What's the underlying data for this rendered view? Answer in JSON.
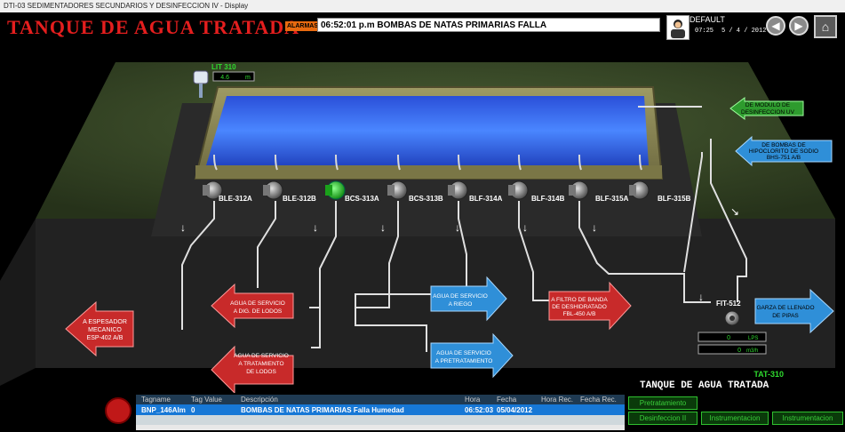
{
  "window": {
    "title": "DTI-03 SEDIMENTADORES SECUNDARIOS Y DESINFECCION IV - Display"
  },
  "header": {
    "title": "TANQUE DE AGUA TRATADA",
    "alarm_label": "ALARMAS",
    "alarm_message": "06:52:01 p.m BOMBAS DE NATAS PRIMARIAS FALLA",
    "user": "DEFAULT",
    "time": "07:25",
    "date": "5 / 4 / 2012"
  },
  "tank": {
    "level_tag": "LIT 310",
    "level_value": "4.6",
    "level_unit": "m"
  },
  "pumps": [
    {
      "label": "BLE-312A",
      "state": "off"
    },
    {
      "label": "BLE-312B",
      "state": "off"
    },
    {
      "label": "BCS-313A",
      "state": "on"
    },
    {
      "label": "BCS-313B",
      "state": "off"
    },
    {
      "label": "BLF-314A",
      "state": "off"
    },
    {
      "label": "BLF-314B",
      "state": "off"
    },
    {
      "label": "BLF-315A",
      "state": "off"
    },
    {
      "label": "BLF-315B",
      "state": "off"
    }
  ],
  "inlets": {
    "uv_line1": "DE MODULO DE",
    "uv_line2": "DESINFECCION UV",
    "hipo_line1": "DE BOMBAS DE",
    "hipo_line2": "HIPOCLORITO DE SODIO",
    "hipo_line3": "BHS-751 A/B"
  },
  "outlets": {
    "espesador_line1": "A ESPESADOR",
    "espesador_line2": "MECANICO",
    "espesador_line3": "ESP-402 A/B",
    "dig_line1": "AGUA DE SERVICIO",
    "dig_line2": "A DIG. DE LODOS",
    "trat_line1": "AGUA DE SERVICIO",
    "trat_line2": "A TRATAMIENTO",
    "trat_line3": "DE LODOS",
    "riego_line1": "AGUA DE SERVICIO",
    "riego_line2": "A RIEGO",
    "pretrat_line1": "AGUA DE SERVICIO",
    "pretrat_line2": "A PRETRATAMIENTO",
    "banda_line1": "A FILTRO DE BANDA",
    "banda_line2": "DE DESHIDRATADO",
    "banda_line3": "FBL-450 A/B",
    "pipas_line1": "GARZA DE LLENADO",
    "pipas_line2": "DE PIPAS"
  },
  "flow_meter": {
    "tag": "FIT-512",
    "flow_value": "0",
    "flow_unit": "LPS",
    "total_value": "0",
    "total_unit": "m3/h"
  },
  "tank_tag": "TAT-310",
  "tank_caption": "TANQUE DE AGUA TRATADA",
  "alarm_table": {
    "columns": [
      "Tagname",
      "Tag Value",
      "Descripción",
      "Hora",
      "Fecha",
      "Hora Rec.",
      "Fecha Rec."
    ],
    "rows": [
      {
        "tagname": "BNP_146Alm",
        "value": "0",
        "description": "BOMBAS DE NATAS PRIMARIAS Falla Humedad",
        "hora": "06:52:03",
        "fecha": "05/04/2012"
      }
    ]
  },
  "nav": {
    "pretratamiento": "Pretratamiento",
    "desinfeccion": "Desinfeccion II",
    "instrumentacion1": "Instrumentacion",
    "instrumentacion2": "Instrumentacion"
  },
  "colors": {
    "title_red": "#e41e1e",
    "pump_on": "#22cc22",
    "arrow_blue": "#2f8fd8",
    "arrow_red": "#c82a2a",
    "arrow_green": "#2c9a2c"
  }
}
